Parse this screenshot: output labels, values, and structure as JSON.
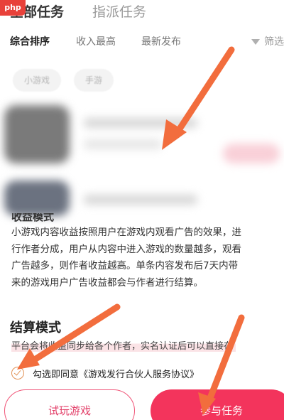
{
  "tabs": {
    "all_tasks": "全部任务",
    "assigned_tasks": "指派任务"
  },
  "watermark": "php中文网",
  "sort": {
    "comprehensive": "综合排序",
    "highest_income": "收入最高",
    "newest": "最新发布",
    "filter": "筛选"
  },
  "chips": {
    "mini_game": "小游戏",
    "mobile_game": "手游"
  },
  "detail": {
    "section_heading_partial": "收益模式",
    "description": "小游戏内容收益按照用户在游戏内观看广告的效果，进\n行作者分成，用户从内容中进入游戏的数量越多，观看\n广告越多，则作者收益越高。单条内容发布后7天内带\n来的游戏用户广告收益都会与作者进行结算。",
    "settlement_title": "结算模式",
    "settlement_text": "平台会将收益同步给各个作者，实名认证后可以直接在"
  },
  "agreement": {
    "prefix": "勾选即同意",
    "link": "《游戏发行合伙人服务协议》"
  },
  "buttons": {
    "trial": "试玩游戏",
    "join": "参与任务"
  },
  "colors": {
    "accent": "#f3345c",
    "arrow": "#f26d3d",
    "check": "#e19256"
  },
  "icons": {
    "filter": "filter-icon",
    "check": "check-circle-icon",
    "arrow": "arrow-annotation"
  }
}
